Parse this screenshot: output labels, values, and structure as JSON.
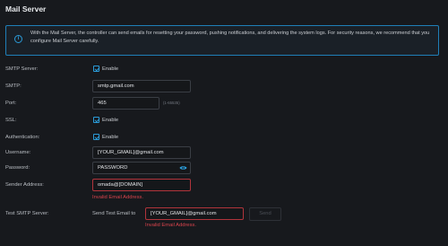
{
  "title": "Mail Server",
  "info": {
    "text": "With the Mail Server, the controller can send emails for resetting your password, pushing notifications, and delivering the system logs. For security reasons, we recommend that you configure Mail Server carefully.",
    "icon": "info-icon"
  },
  "smtp_server": {
    "label": "SMTP Server:",
    "enable_label": "Enable",
    "checked": true
  },
  "smtp": {
    "label": "SMTP:",
    "value": "smtp.gmail.com"
  },
  "port": {
    "label": "Port:",
    "value": "465",
    "hint": "(1-65535)"
  },
  "ssl": {
    "label": "SSL:",
    "enable_label": "Enable",
    "checked": true
  },
  "authentication": {
    "label": "Authentication:",
    "enable_label": "Enable",
    "checked": true
  },
  "username": {
    "label": "Username:",
    "value": "[YOUR_GMAIL]@gmail.com"
  },
  "password": {
    "label": "Password:",
    "value": "PASSWORD",
    "icon": "eye-icon"
  },
  "sender": {
    "label": "Sender Address:",
    "value": "omada@[DOMAIN]",
    "error": "Invalid Email Address."
  },
  "test": {
    "label": "Test SMTP Server:",
    "send_to_label": "Send Test Email to",
    "value": "[YOUR_GMAIL]@gmail.com",
    "error": "Invalid Email Address.",
    "button": "Send"
  },
  "colors": {
    "accent": "#2b9bd8",
    "error": "#d8434c",
    "background": "#17191d"
  }
}
